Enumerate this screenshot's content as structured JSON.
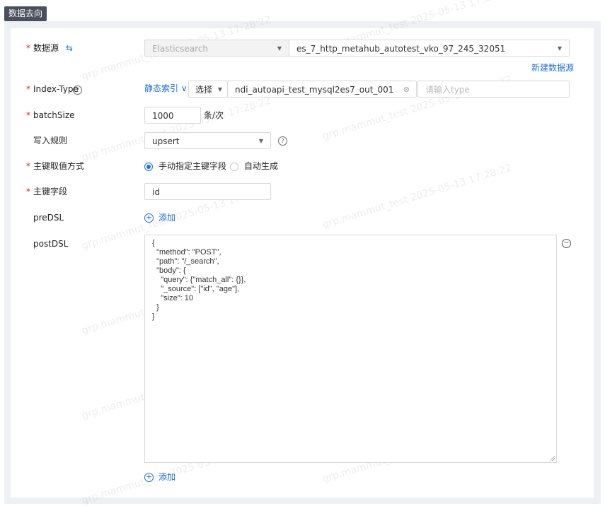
{
  "section_title": "数据去向",
  "watermark": "grp.mammut_test 2025-05-13 17:28:22",
  "datasource": {
    "label": "数据源",
    "type_value": "Elasticsearch",
    "source_value": "es_7_http_metahub_autotest_vko_97_245_32051",
    "new_link": "新建数据源"
  },
  "index_type": {
    "label": "Index-Type",
    "mode": "静态索引",
    "select_label": "选择",
    "index_value": "ndi_autoapi_test_mysql2es7_out_001",
    "type_placeholder": "请输入type"
  },
  "batch": {
    "label": "batchSize",
    "value": "1000",
    "unit": "条/次"
  },
  "write_rule": {
    "label": "写入规则",
    "value": "upsert"
  },
  "pk_mode": {
    "label": "主键取值方式",
    "option_manual": "手动指定主键字段",
    "option_auto": "自动生成"
  },
  "pk_field": {
    "label": "主键字段",
    "value": "id"
  },
  "predsl": {
    "label": "preDSL",
    "add": "添加"
  },
  "postdsl": {
    "label": "postDSL",
    "lines": [
      "{",
      "  \"method\": \"POST\",",
      "  \"path\": \"/_search\",",
      "  \"body\": {",
      "    \"query\": {\"match_all\": {}},",
      "    \"_source\": [\"id\", \"age\"],",
      "    \"size\": 10",
      "  }",
      "}"
    ],
    "add": "添加"
  }
}
